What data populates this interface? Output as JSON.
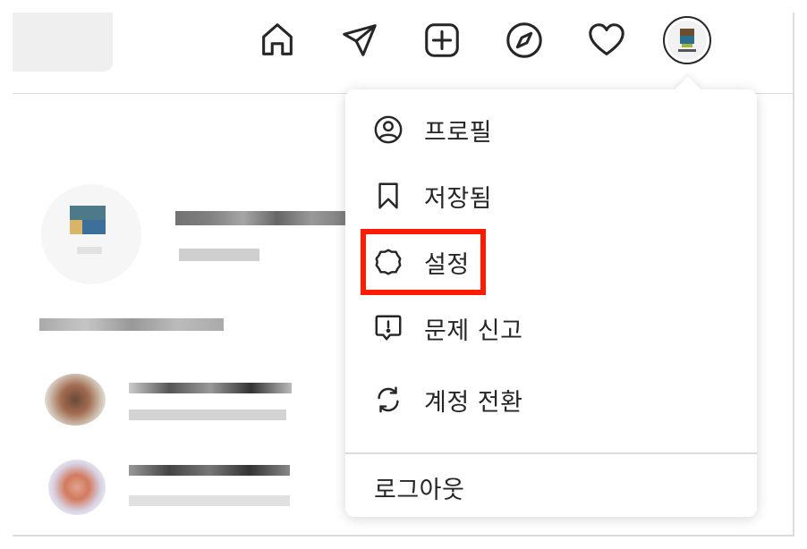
{
  "topnav": {
    "icons": [
      "home-icon",
      "direct-message-icon",
      "new-post-icon",
      "explore-icon",
      "activity-heart-icon",
      "profile-avatar"
    ]
  },
  "dropdown": {
    "items": [
      {
        "label": "프로필",
        "icon": "profile-circle-icon"
      },
      {
        "label": "저장됨",
        "icon": "bookmark-icon"
      },
      {
        "label": "설정",
        "icon": "settings-gear-icon"
      },
      {
        "label": "문제 신고",
        "icon": "report-problem-icon"
      },
      {
        "label": "계정 전환",
        "icon": "switch-account-icon"
      }
    ],
    "logout_label": "로그아웃"
  },
  "highlight": {
    "target": "설정",
    "color": "#ff1a00"
  }
}
